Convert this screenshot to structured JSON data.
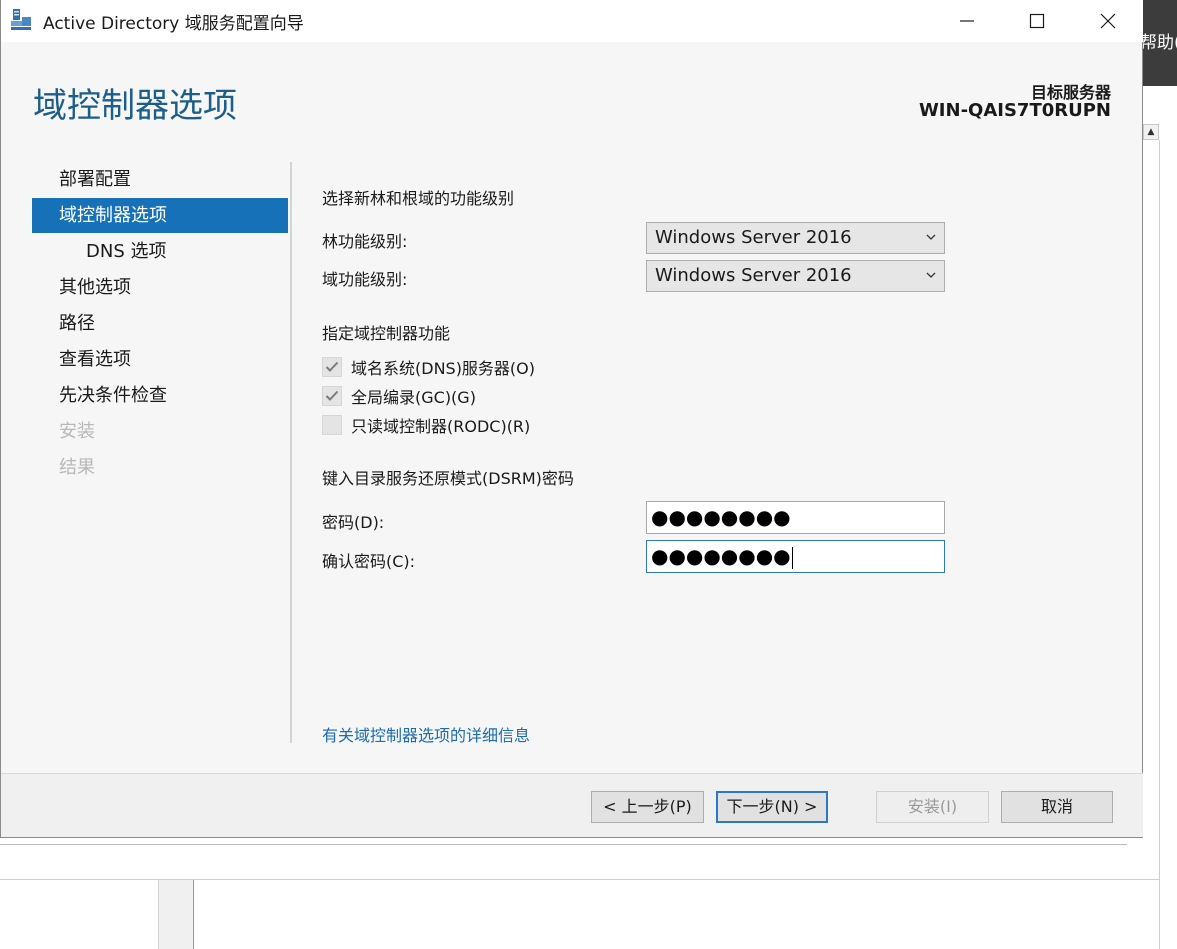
{
  "background": {
    "help_text": "帮助(H"
  },
  "window": {
    "title": "Active Directory 域服务配置向导",
    "controls": {
      "minimize": "minimize",
      "maximize": "maximize",
      "close": "close"
    }
  },
  "header": {
    "page_title": "域控制器选项",
    "target_label": "目标服务器",
    "target_name": "WIN-QAIS7T0RUPN"
  },
  "nav": {
    "items": [
      {
        "label": "部署配置",
        "state": "normal"
      },
      {
        "label": "域控制器选项",
        "state": "selected"
      },
      {
        "label": "DNS 选项",
        "state": "sub"
      },
      {
        "label": "其他选项",
        "state": "normal"
      },
      {
        "label": "路径",
        "state": "normal"
      },
      {
        "label": "查看选项",
        "state": "normal"
      },
      {
        "label": "先决条件检查",
        "state": "normal"
      },
      {
        "label": "安装",
        "state": "disabled"
      },
      {
        "label": "结果",
        "state": "disabled"
      }
    ]
  },
  "functional_level": {
    "heading": "选择新林和根域的功能级别",
    "forest_label": "林功能级别:",
    "forest_value": "Windows Server 2016",
    "domain_label": "域功能级别:",
    "domain_value": "Windows Server 2016"
  },
  "capabilities": {
    "heading": "指定域控制器功能",
    "items": [
      {
        "label": "域名系统(DNS)服务器(O)",
        "checked": true,
        "enabled": false
      },
      {
        "label": "全局编录(GC)(G)",
        "checked": true,
        "enabled": false
      },
      {
        "label": "只读域控制器(RODC)(R)",
        "checked": false,
        "enabled": true
      }
    ]
  },
  "dsrm": {
    "heading": "键入目录服务还原模式(DSRM)密码",
    "password_label": "密码(D):",
    "password_value": "●●●●●●●●",
    "confirm_label": "确认密码(C):",
    "confirm_value": "●●●●●●●●"
  },
  "more_info_link": "有关域控制器选项的详细信息",
  "buttons": {
    "back": "< 上一步(P)",
    "next": "下一步(N) >",
    "install": "安装(I)",
    "cancel": "取消"
  },
  "colors": {
    "accent": "#1771b8",
    "title": "#1d5d8b",
    "link": "#1c6bb3",
    "focus": "#2e76c9"
  }
}
